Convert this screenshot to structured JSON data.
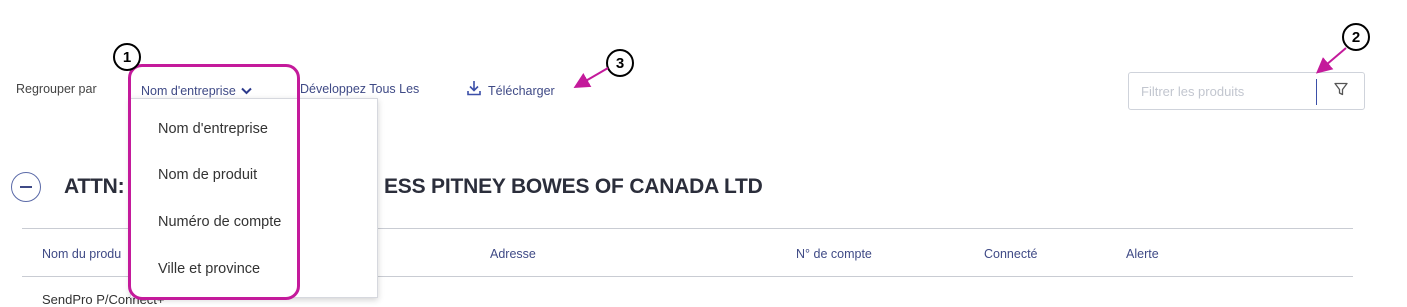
{
  "toolbar": {
    "group_by_label": "Regrouper par",
    "group_by_value": "Nom d'entreprise",
    "expand_all_label": "Développez Tous Les",
    "download_label": "Télécharger"
  },
  "filter": {
    "placeholder": "Filtrer les produits",
    "value": ""
  },
  "dropdown": {
    "options": [
      "Nom d'entreprise",
      "Nom de produit",
      "Numéro de compte",
      "Ville et province"
    ]
  },
  "group": {
    "title_prefix": "ATTN:",
    "title_suffix": "ESS PITNEY BOWES OF CANADA LTD"
  },
  "table": {
    "columns": [
      "Nom du produ",
      "Adresse",
      "N° de compte",
      "Connecté",
      "Alerte"
    ],
    "first_row_partial": "SendPro P/Connect+"
  },
  "annotations": {
    "callouts": [
      "1",
      "2",
      "3"
    ],
    "highlight_color": "#c41a9b"
  },
  "colors": {
    "link_text": "#3f4a86",
    "accent_blue": "#3b4fa8",
    "highlight": "#c41a9b"
  }
}
